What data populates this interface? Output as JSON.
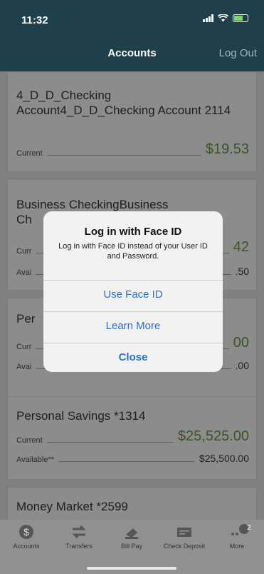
{
  "status": {
    "time": "11:32"
  },
  "header": {
    "title": "Accounts",
    "logout_label": "Log Out"
  },
  "accounts": [
    {
      "name": "4_D_D_Checking Account4_D_D_Checking Account 2114",
      "current_label": "Current",
      "current_value": "$19.53"
    },
    {
      "name_line1": "Business CheckingBusiness",
      "name_partial": "Ch",
      "current_label_partial": "Curr",
      "current_value_partial": "42",
      "available_label_partial": "Avai",
      "available_value_partial": ".50"
    },
    {
      "name_partial": "Per",
      "current_label_partial": "Curr",
      "current_value_partial": "00",
      "available_label_partial": "Avai",
      "available_value_partial": ".00"
    },
    {
      "name": "Personal Savings *1314",
      "current_label": "Current",
      "current_value": "$25,525.00",
      "available_label": "Available**",
      "available_value": "$25,500.00"
    },
    {
      "name": "Money Market *2599"
    }
  ],
  "dialog": {
    "title": "Log in with Face ID",
    "message": "Log in with Face ID instead of your User ID and Password.",
    "use_face_id": "Use Face ID",
    "learn_more": "Learn More",
    "close": "Close"
  },
  "tabs": [
    {
      "label": "Accounts",
      "icon": "dollar-circle-icon"
    },
    {
      "label": "Transfers",
      "icon": "transfer-arrows-icon"
    },
    {
      "label": "Bill Pay",
      "icon": "bill-pay-icon"
    },
    {
      "label": "Check Deposit",
      "icon": "check-deposit-icon"
    },
    {
      "label": "More",
      "icon": "more-dots-icon",
      "badge": "2"
    }
  ],
  "colors": {
    "header_bg": "#1e3f4c",
    "amount_green": "#5a8a3c",
    "ios_blue": "#2a6fd6"
  }
}
